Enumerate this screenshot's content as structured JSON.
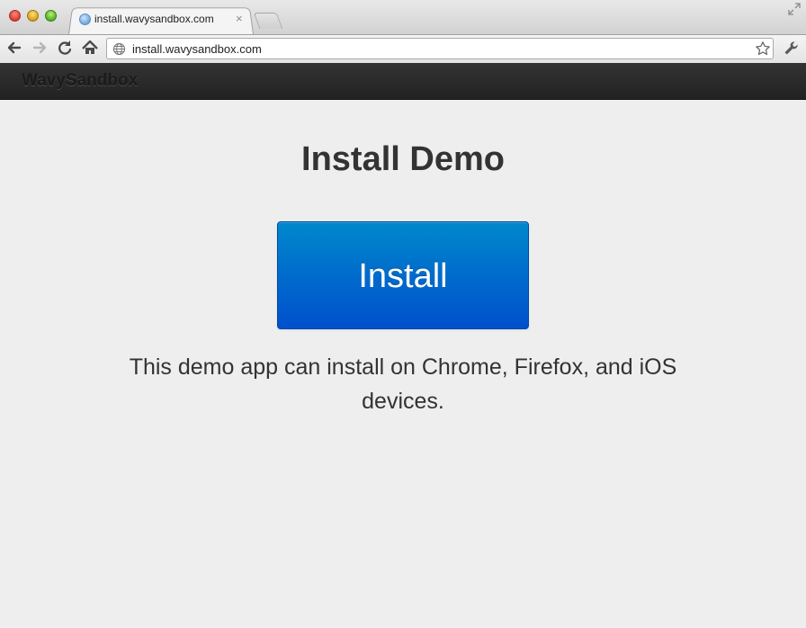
{
  "browser": {
    "tab": {
      "title": "install.wavysandbox.com",
      "favicon": "globe-favicon-icon",
      "close_glyph": "×"
    },
    "address_bar": {
      "url": "install.wavysandbox.com"
    },
    "icons": [
      "back-icon",
      "forward-icon",
      "reload-icon",
      "home-icon",
      "globe-icon",
      "star-icon",
      "wrench-icon"
    ]
  },
  "navbar": {
    "brand": "WavySandbox"
  },
  "main": {
    "title": "Install Demo",
    "install_button_label": "Install",
    "description": "This demo app can install on Chrome, Firefox, and iOS devices."
  },
  "colors": {
    "navbar_bg": "#222222",
    "button_top": "#0088cc",
    "button_bottom": "#0050cc",
    "page_bg": "#eeeeee",
    "text": "#333333"
  }
}
